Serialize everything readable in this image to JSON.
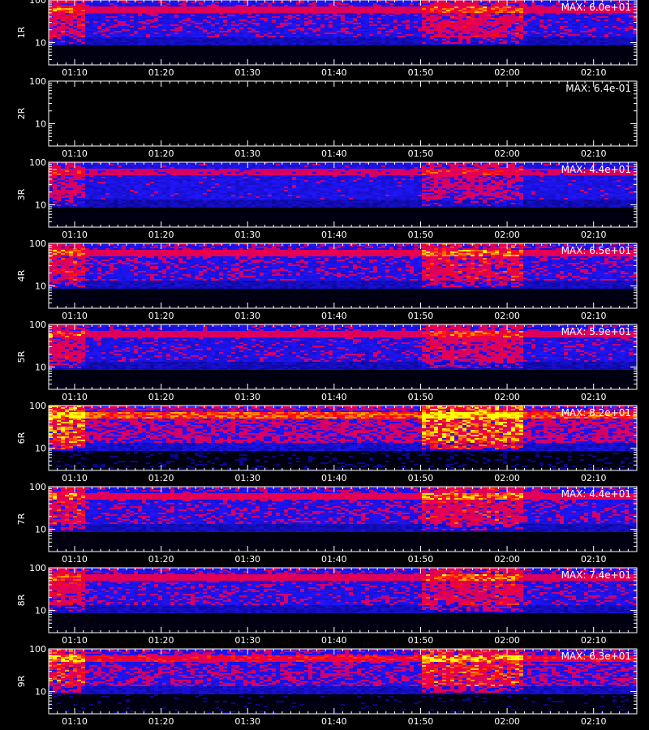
{
  "chart_data": {
    "type": "heatmap",
    "y_scale": "log",
    "ylim": [
      3,
      100
    ],
    "y_ticks": [
      10,
      100
    ],
    "y_tick_labels": [
      "10",
      "100"
    ],
    "x_range": [
      "01:07",
      "02:15"
    ],
    "x_ticks": [
      "01:10",
      "01:20",
      "01:30",
      "01:40",
      "01:50",
      "02:00",
      "02:10"
    ],
    "colormap": [
      "#000000",
      "#0000ff",
      "#ff0000",
      "#ffff00"
    ],
    "annotation_prefix": "MAX:",
    "panels": [
      {
        "label": "1R",
        "max": "6.0e+01",
        "level": 0.7
      },
      {
        "label": "2R",
        "max": "6.4e-01",
        "level": 0.0
      },
      {
        "label": "3R",
        "max": "4.4e+01",
        "level": 0.6
      },
      {
        "label": "4R",
        "max": "6.5e+01",
        "level": 0.75
      },
      {
        "label": "5R",
        "max": "5.9e+01",
        "level": 0.68
      },
      {
        "label": "6R",
        "max": "8.2e+01",
        "level": 1.0
      },
      {
        "label": "7R",
        "max": "4.4e+01",
        "level": 0.75
      },
      {
        "label": "8R",
        "max": "7.4e+01",
        "level": 0.72
      },
      {
        "label": "9R",
        "max": "6.3e+01",
        "level": 0.85
      }
    ],
    "bright_intervals": [
      [
        "01:07",
        "01:11"
      ],
      [
        "01:50",
        "02:02"
      ]
    ],
    "xlabel": ""
  }
}
